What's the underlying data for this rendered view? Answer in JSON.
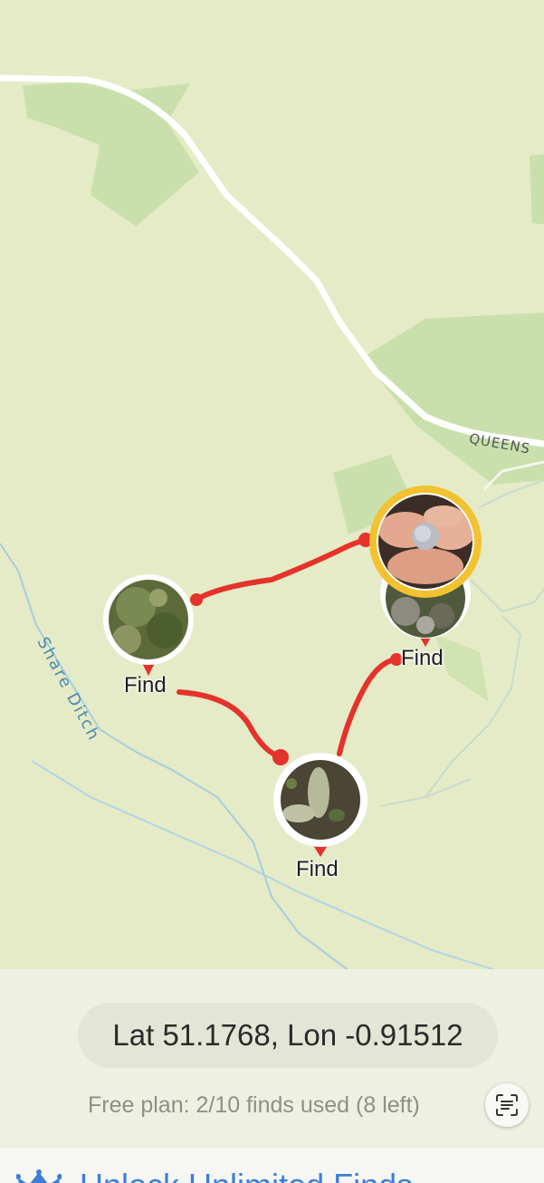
{
  "map": {
    "street_label": "QUEENS",
    "water_label": "Share Ditch",
    "pins": [
      {
        "id": "left",
        "label": "Find",
        "photo": "moss-stone"
      },
      {
        "id": "right",
        "label": "Find",
        "photo": "debris"
      },
      {
        "id": "bottom",
        "label": "Find",
        "photo": "flint-stones"
      }
    ],
    "selected_pin": {
      "photo": "coin-in-fingers"
    },
    "route_color": "#e5322b",
    "selected_ring_color": "#f2c230"
  },
  "location": {
    "coords": "Lat 51.1768, Lon -0.91512"
  },
  "plan": {
    "status": "Free plan: 2/10 finds used (8 left)"
  },
  "unlock": {
    "label": "Unlock Unlimited Finds",
    "icon": "crown-icon"
  },
  "scan_button": {
    "icon": "scan-text-icon"
  }
}
